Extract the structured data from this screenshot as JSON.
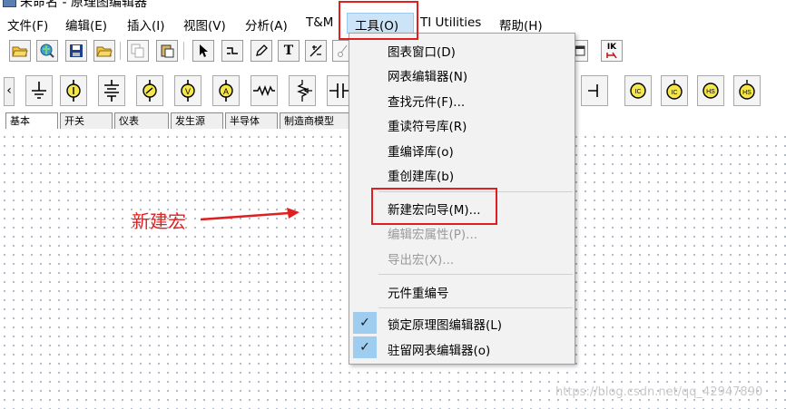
{
  "window": {
    "title": "未命名 - 原理图编辑器"
  },
  "menubar": {
    "items": [
      {
        "label": "文件(F)"
      },
      {
        "label": "编辑(E)"
      },
      {
        "label": "插入(I)"
      },
      {
        "label": "视图(V)"
      },
      {
        "label": "分析(A)"
      },
      {
        "label": "T&M"
      },
      {
        "label": "工具(O)"
      },
      {
        "label": "TI Utilities"
      },
      {
        "label": "帮助(H)"
      }
    ]
  },
  "tools_menu": {
    "items": [
      {
        "label": "图表窗口(D)"
      },
      {
        "label": "网表编辑器(N)"
      },
      {
        "label": "查找元件(F)..."
      },
      {
        "label": "重读符号库(R)"
      },
      {
        "label": "重编译库(o)"
      },
      {
        "label": "重创建库(b)"
      },
      {
        "label": "新建宏向导(M)..."
      },
      {
        "label": "编辑宏属性(P)..."
      },
      {
        "label": "导出宏(X)..."
      },
      {
        "label": "元件重编号"
      },
      {
        "label": "锁定原理图编辑器(L)"
      },
      {
        "label": "驻留网表编辑器(o)"
      }
    ],
    "check_glyph": "✓"
  },
  "toolbar": {
    "text_tool": "T",
    "labels": [
      "IK"
    ]
  },
  "parts_tabs": {
    "items": [
      {
        "label": "基本"
      },
      {
        "label": "开关"
      },
      {
        "label": "仪表"
      },
      {
        "label": "发生源"
      },
      {
        "label": "半导体"
      },
      {
        "label": "制造商模型"
      }
    ]
  },
  "parts": {
    "meter_v": "V",
    "meter_a": "A",
    "ic": "IC",
    "hs": "HS"
  },
  "annotation": {
    "label": "新建宏",
    "color": "#e02020"
  },
  "watermark": "https://blog.csdn.net/qq_42947890",
  "colors": {
    "highlight": "#e02020",
    "menu_selected": "#cce4f7",
    "check_bg": "#9fcdf0"
  }
}
